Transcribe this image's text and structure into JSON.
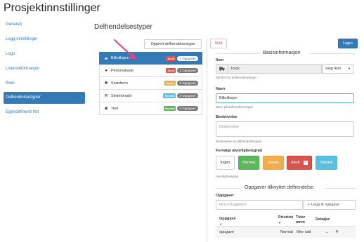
{
  "page_title": "Prosjektinnstillinger",
  "sidebar": {
    "items": [
      {
        "label": "Generelt",
        "active": false
      },
      {
        "label": "Logg-innstillinger",
        "active": false
      },
      {
        "label": "Logo",
        "active": false
      },
      {
        "label": "Lisensinformasjon",
        "active": false
      },
      {
        "label": "Rom",
        "active": false
      },
      {
        "label": "Delhendelsestyper",
        "active": true
      },
      {
        "label": "Egendefinerte felt",
        "active": false
      }
    ]
  },
  "section_title": "Delhendelsestyper",
  "create_button": "Opprett delhendelsestype",
  "delete_button": "Slett",
  "save_button": "Lagre",
  "types": [
    {
      "icon": "truck-icon",
      "glyph": "▰",
      "label": "Bilkollisjon",
      "severity": "Akutt",
      "severity_color": "#d9534f",
      "count": "1 Oppgaver",
      "active": true
    },
    {
      "icon": "user-icon",
      "glyph": "●",
      "label": "Personskade",
      "severity": "Akutt",
      "severity_color": "#d9534f",
      "count": "1 Oppgaver",
      "active": false
    },
    {
      "icon": "snowflake-icon",
      "glyph": "✱",
      "label": "Snøstorm",
      "severity": "Høster",
      "severity_color": "#f0ad4e",
      "count": "0 Oppgaver",
      "active": false
    },
    {
      "icon": "wrench-icon",
      "glyph": "⚒",
      "label": "Strømbrudd",
      "severity": "Teknisk",
      "severity_color": "#5bc0de",
      "count": "0 Oppgaver",
      "active": false
    },
    {
      "icon": "camera-icon",
      "glyph": "◙",
      "label": "Test",
      "severity": "Normal",
      "severity_color": "#5cb85c",
      "count": "0 Oppgaver",
      "active": false
    }
  ],
  "basic_info": {
    "header": "Basisinformasjon",
    "icon_label": "Ikon",
    "icon_value": "truck",
    "icon_help": "Symbol for delhendelsestype",
    "choose_icon": "Velg ikon",
    "name_label": "Navn",
    "name_value": "Bilkollisjon",
    "name_help": "Navn på delhendelsestype",
    "desc_label": "Beskrivelse",
    "desc_placeholder": "Beskrivelse",
    "desc_help": "Beskrivelse av delhendelsestype",
    "severity_label": "Forvalgt alvorlighetsgrad",
    "severity_help": "Alvorlighetsgrad",
    "severity_options": [
      {
        "label": "Ingen",
        "bg": "#ffffff",
        "fg": "#333333",
        "selected": false
      },
      {
        "label": "Normal",
        "bg": "#5cb85c",
        "fg": "#ffffff",
        "selected": false
      },
      {
        "label": "Høster",
        "bg": "#f0ad4e",
        "fg": "#ffffff",
        "selected": false
      },
      {
        "label": "Akutt",
        "bg": "#d9534f",
        "fg": "#ffffff",
        "selected": true
      },
      {
        "label": "Teknisk",
        "bg": "#5bc0de",
        "fg": "#ffffff",
        "selected": false
      }
    ]
  },
  "tasks": {
    "header": "Oppgaver tilknyttet delhendelse",
    "label": "Oppgaver",
    "input_placeholder": "Hva må gjøres?",
    "add_button": "Legg til oppgave",
    "columns": [
      "Oppgave",
      "Prioritet",
      "Tidsramme",
      "Detaljer"
    ],
    "rows": [
      {
        "task": "oppgave",
        "priority": "Normal",
        "timeframe": "Ikke satt"
      }
    ]
  }
}
